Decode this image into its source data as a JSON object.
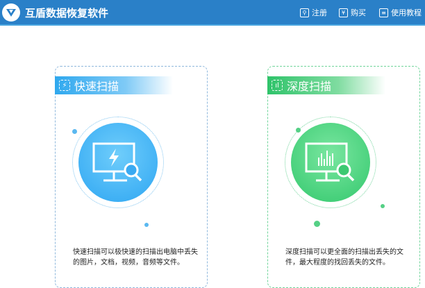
{
  "header": {
    "title": "互盾数据恢复软件",
    "nav": [
      {
        "label": "注册",
        "icon": "key-icon"
      },
      {
        "label": "购买",
        "icon": "yen-icon"
      },
      {
        "label": "使用教程",
        "icon": "document-icon"
      }
    ]
  },
  "cards": [
    {
      "title": "快速扫描",
      "description": "快速扫描可以极快速的扫描出电脑中丢失的图片，文档，视频，音频等文件。",
      "color": "#2fa8ee"
    },
    {
      "title": "深度扫描",
      "description": "深度扫描可以更全面的扫描出丢失的文件，最大程度的找回丢失的文件。",
      "color": "#2fc36a"
    }
  ]
}
